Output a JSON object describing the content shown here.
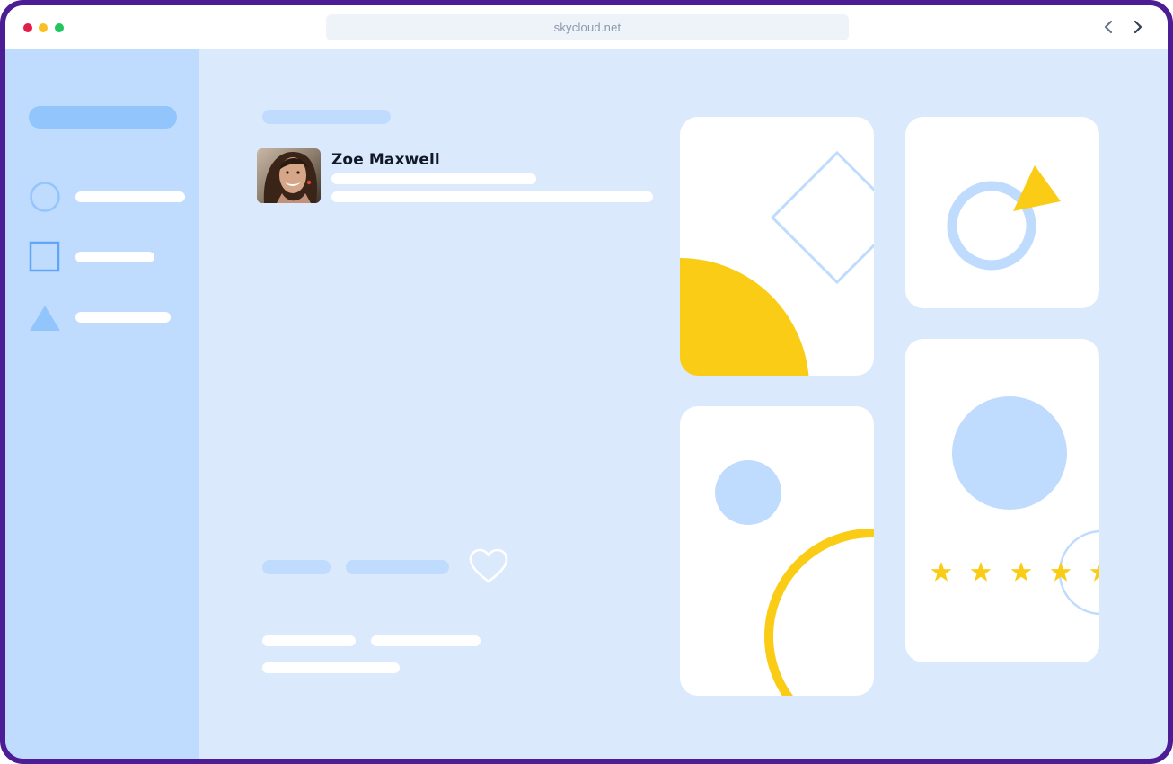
{
  "browser": {
    "url": "skycloud.net",
    "nav": {
      "back_icon": "chevron-left-icon",
      "forward_icon": "chevron-right-icon"
    }
  },
  "sidebar": {
    "items": [
      {
        "icon": "circle-icon"
      },
      {
        "icon": "square-icon"
      },
      {
        "icon": "triangle-icon"
      }
    ]
  },
  "profile": {
    "name": "Zoe Maxwell"
  },
  "rating": {
    "visible_stars": 5
  },
  "colors": {
    "frame": "#4c1d95",
    "background": "#dbe9fd",
    "sidebar": "#bfdbfe",
    "accent_blue": "#93c5fd",
    "accent_yellow": "#facc15"
  }
}
